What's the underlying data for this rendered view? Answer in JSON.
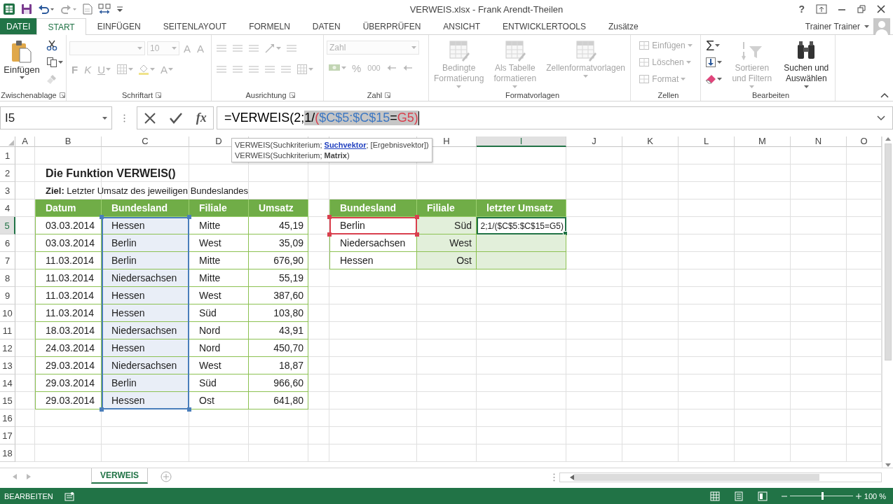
{
  "title_bar": {
    "title": "VERWEIS.xlsx - Frank Arendt-Theilen",
    "help": "?"
  },
  "ribbon": {
    "tabs": [
      {
        "label": "DATEI",
        "kind": "file",
        "selected": false
      },
      {
        "label": "START",
        "kind": "tab",
        "selected": true
      },
      {
        "label": "EINFÜGEN",
        "kind": "tab",
        "selected": false
      },
      {
        "label": "SEITENLAYOUT",
        "kind": "tab",
        "selected": false
      },
      {
        "label": "FORMELN",
        "kind": "tab",
        "selected": false
      },
      {
        "label": "DATEN",
        "kind": "tab",
        "selected": false
      },
      {
        "label": "ÜBERPRÜFEN",
        "kind": "tab",
        "selected": false
      },
      {
        "label": "ANSICHT",
        "kind": "tab",
        "selected": false
      },
      {
        "label": "ENTWICKLERTOOLS",
        "kind": "tab",
        "selected": false
      },
      {
        "label": "Zusätze",
        "kind": "tab",
        "selected": false
      }
    ],
    "user": "Trainer Trainer",
    "groups": [
      {
        "label": "Zwischenablage",
        "kind": "columns",
        "launcher": true,
        "items": [
          [
            {
              "kind": "big",
              "label": "Einfügen",
              "dropdown": true,
              "disabled": false
            }
          ],
          [
            {
              "kind": "tool",
              "dropdown": false,
              "disabled": false
            },
            {
              "kind": "tool",
              "dropdown": true,
              "disabled": false
            },
            {
              "kind": "tool",
              "dropdown": false,
              "disabled": true
            }
          ]
        ]
      },
      {
        "label": "Schriftart",
        "kind": "rows",
        "launcher": true,
        "items": [
          [
            {
              "kind": "combo",
              "disabled": true
            },
            {
              "kind": "combo",
              "value": "10",
              "disabled": true
            },
            {
              "kind": "glyph",
              "label": "A",
              "dropdown": false,
              "disabled": true
            },
            {
              "kind": "glyph",
              "label": "A",
              "dropdown": false,
              "disabled": true
            }
          ],
          [
            {
              "kind": "glyph",
              "label": "F",
              "dropdown": false,
              "disabled": true
            },
            {
              "kind": "glyph",
              "label": "K",
              "dropdown": false,
              "disabled": true
            },
            {
              "kind": "glyph",
              "label": "U",
              "dropdown": true,
              "disabled": true
            },
            {
              "kind": "tool",
              "dropdown": true,
              "disabled": true
            },
            {
              "kind": "tool",
              "dropdown": true,
              "disabled": true
            },
            {
              "kind": "glyph",
              "label": "A",
              "dropdown": true,
              "disabled": true
            }
          ]
        ]
      },
      {
        "label": "Ausrichtung",
        "kind": "rows",
        "launcher": true,
        "items": [
          [
            {
              "kind": "tool",
              "dropdown": false,
              "disabled": true
            },
            {
              "kind": "tool",
              "dropdown": false,
              "disabled": true
            },
            {
              "kind": "tool",
              "dropdown": false,
              "disabled": true
            },
            {
              "kind": "tool",
              "dropdown": true,
              "disabled": true
            },
            {
              "kind": "tool",
              "dropdown": false,
              "disabled": true
            }
          ],
          [
            {
              "kind": "tool",
              "dropdown": false,
              "disabled": true
            },
            {
              "kind": "tool",
              "dropdown": false,
              "disabled": true
            },
            {
              "kind": "tool",
              "dropdown": false,
              "disabled": true
            },
            {
              "kind": "tool",
              "dropdown": false,
              "disabled": true
            },
            {
              "kind": "tool",
              "dropdown": false,
              "disabled": true
            },
            {
              "kind": "tool",
              "dropdown": true,
              "disabled": true
            }
          ]
        ]
      },
      {
        "label": "Zahl",
        "kind": "rows",
        "launcher": true,
        "items": [
          [
            {
              "kind": "combo",
              "value": "Zahl",
              "disabled": true
            }
          ],
          [
            {
              "kind": "tool",
              "dropdown": true,
              "disabled": true
            },
            {
              "kind": "glyph",
              "label": "%",
              "dropdown": false,
              "disabled": true
            },
            {
              "kind": "glyph",
              "label": "000",
              "dropdown": false,
              "disabled": true
            },
            {
              "kind": "tool",
              "dropdown": false,
              "disabled": true
            },
            {
              "kind": "tool",
              "dropdown": false,
              "disabled": true
            }
          ]
        ]
      },
      {
        "label": "Formatvorlagen",
        "kind": "columns",
        "launcher": false,
        "items": [
          [
            {
              "kind": "big",
              "label": "Bedingte Formatierung",
              "dropdown": true,
              "disabled": true
            }
          ],
          [
            {
              "kind": "big",
              "label": "Als Tabelle formatieren",
              "dropdown": true,
              "disabled": true
            }
          ],
          [
            {
              "kind": "big",
              "label": "Zellenformatvorlagen",
              "dropdown": true,
              "disabled": true
            }
          ]
        ]
      },
      {
        "label": "Zellen",
        "kind": "columns",
        "launcher": false,
        "items": [
          [
            {
              "kind": "small",
              "label": "Einfügen",
              "dropdown": true,
              "disabled": true
            },
            {
              "kind": "small",
              "label": "Löschen",
              "dropdown": true,
              "disabled": true
            },
            {
              "kind": "small",
              "label": "Format",
              "dropdown": true,
              "disabled": true
            }
          ]
        ]
      },
      {
        "label": "Bearbeiten",
        "kind": "columns",
        "launcher": false,
        "items": [
          [
            {
              "kind": "glyph",
              "label": "Σ",
              "dropdown": true,
              "disabled": false
            },
            {
              "kind": "tool",
              "dropdown": true,
              "disabled": false
            },
            {
              "kind": "tool",
              "dropdown": true,
              "disabled": false
            }
          ],
          [
            {
              "kind": "big",
              "label": "Sortieren und Filtern",
              "dropdown": true,
              "disabled": true
            }
          ],
          [
            {
              "kind": "big",
              "label": "Suchen und Auswählen",
              "dropdown": true,
              "disabled": false
            }
          ]
        ]
      }
    ]
  },
  "formula_bar": {
    "name_box": "I5",
    "fx": "fx",
    "formula": [
      {
        "text": "=VERWEIS(2;",
        "color": "#000000",
        "selected": false
      },
      {
        "text": "1/",
        "color": "#000000",
        "selected": true
      },
      {
        "text": "(",
        "color": "#d9404e",
        "selected": true
      },
      {
        "text": "$C$5:$C$15",
        "color": "#3e78c2",
        "selected": true
      },
      {
        "text": "=",
        "color": "#000000",
        "selected": true
      },
      {
        "text": "G5",
        "color": "#d9404e",
        "selected": true
      },
      {
        "text": ")",
        "color": "#d9404e",
        "selected": true
      }
    ]
  },
  "tooltip": {
    "lines": [
      {
        "before": "VERWEIS(Suchkriterium; ",
        "link": "Suchvektor",
        "after": "; [Ergebnisvektor])"
      },
      {
        "text": "VERWEIS(Suchkriterium; **Matrix**)"
      }
    ]
  },
  "sheet": {
    "columns": [
      {
        "label": "A",
        "selected": false
      },
      {
        "label": "B",
        "selected": false
      },
      {
        "label": "C",
        "selected": false
      },
      {
        "label": "D",
        "selected": false
      },
      {
        "selected": false
      },
      {
        "selected": false
      },
      {
        "selected": false
      },
      {
        "label": "H",
        "selected": false
      },
      {
        "label": "I",
        "selected": true
      },
      {
        "label": "J",
        "selected": false
      },
      {
        "label": "K",
        "selected": false
      },
      {
        "label": "L",
        "selected": false
      },
      {
        "label": "M",
        "selected": false
      },
      {
        "label": "N",
        "selected": false
      },
      {
        "label": "O",
        "selected": false
      }
    ],
    "rows": [
      {
        "label": "1",
        "selected": false
      },
      {
        "label": "2",
        "selected": false
      },
      {
        "label": "3",
        "selected": false
      },
      {
        "label": "4",
        "selected": false
      },
      {
        "label": "5",
        "selected": true
      },
      {
        "label": "6",
        "selected": false
      },
      {
        "label": "7",
        "selected": false
      },
      {
        "label": "8",
        "selected": false
      },
      {
        "label": "9",
        "selected": false
      },
      {
        "label": "10",
        "selected": false
      },
      {
        "label": "11",
        "selected": false
      },
      {
        "label": "12",
        "selected": false
      },
      {
        "label": "13",
        "selected": false
      },
      {
        "label": "14",
        "selected": false
      },
      {
        "label": "15",
        "selected": false
      },
      {
        "label": "16",
        "selected": false
      },
      {
        "label": "17",
        "selected": false
      },
      {
        "label": "18",
        "selected": false
      }
    ],
    "title": "Die Funktion VERWEIS()",
    "goal": "**Ziel:** Letzter Umsatz des jeweiligen Bundeslandes",
    "table_1": {
      "columns": [
        {
          "label": "Datum"
        },
        {
          "label": "Bundesland",
          "color": "#4a7ebb"
        },
        {
          "label": "Filiale"
        },
        {
          "label": "Umsatz"
        }
      ],
      "rows": [
        [
          "03.03.2014",
          "Hessen",
          "Mitte",
          "45,19"
        ],
        [
          "03.03.2014",
          "Berlin",
          "West",
          "35,09"
        ],
        [
          "11.03.2014",
          "Berlin",
          "Mitte",
          "676,90"
        ],
        [
          "11.03.2014",
          "Niedersachsen",
          "Mitte",
          "55,19"
        ],
        [
          "11.03.2014",
          "Hessen",
          "West",
          "387,60"
        ],
        [
          "11.03.2014",
          "Hessen",
          "Süd",
          "103,80"
        ],
        [
          "18.03.2014",
          "Niedersachsen",
          "Nord",
          "43,91"
        ],
        [
          "24.03.2014",
          "Hessen",
          "Nord",
          "450,70"
        ],
        [
          "29.03.2014",
          "Niedersachsen",
          "West",
          "18,87"
        ],
        [
          "29.03.2014",
          "Berlin",
          "Süd",
          "966,60"
        ],
        [
          "29.03.2014",
          "Hessen",
          "Ost",
          "641,80"
        ]
      ]
    },
    "table_2": {
      "columns": [
        {
          "label": "Bundesland",
          "shaded": false
        },
        {
          "label": "Filiale",
          "shaded": true
        },
        {
          "label": "letzter Umsatz",
          "shaded": true
        }
      ],
      "rows": [
        [
          {
            "text": "Berlin",
            "color": "#d9404e",
            "active": false
          },
          {
            "text": "Süd",
            "active": false
          },
          {
            "text": "2;1/($C$5:$C$15=G5)",
            "active": true
          }
        ],
        [
          {
            "text": "Niedersachsen",
            "active": false
          },
          {
            "text": "West",
            "active": false
          },
          {
            "active": false
          }
        ],
        [
          {
            "text": "Hessen",
            "active": false
          },
          {
            "text": "Ost",
            "active": false
          },
          {
            "active": false
          }
        ]
      ]
    }
  },
  "sheet_tabs": [
    {
      "label": "VERWEIS",
      "selected": true
    }
  ],
  "status_bar": {
    "mode": "BEARBEITEN",
    "zoom": {
      "level": 0.5
    },
    "zoom_label": "100 %"
  }
}
